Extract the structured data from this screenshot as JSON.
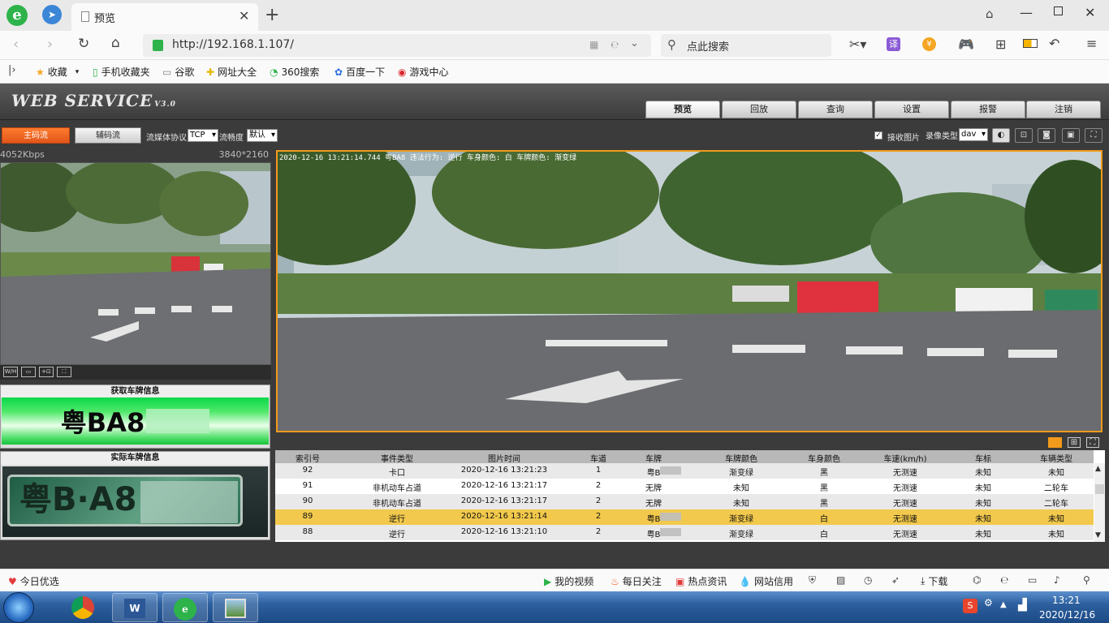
{
  "browser": {
    "tab_title": "预览",
    "url": "http://192.168.1.107/",
    "search_placeholder": "点此搜索",
    "translate_label": "译",
    "favorites": [
      "收藏",
      "手机收藏夹",
      "谷歌",
      "网址大全",
      "360搜索",
      "百度一下",
      "游戏中心"
    ]
  },
  "app": {
    "logo": "WEB SERVICE",
    "logo_version": "V3.0",
    "nav_tabs": [
      "预览",
      "回放",
      "查询",
      "设置",
      "报警",
      "注销"
    ],
    "active_tab": "预览",
    "toolbar": {
      "main_stream": "主码流",
      "sub_stream": "辅码流",
      "protocol_label": "流媒体协议",
      "protocol_value": "TCP",
      "smooth_label": "流畅度",
      "smooth_value": "默认",
      "receive_image_label": "接收图片",
      "record_type_label": "录像类型",
      "record_type_value": "dav"
    },
    "stream_info": {
      "bitrate": "4052Kbps",
      "resolution": "3840*2160"
    },
    "thumb_tools": [
      "W/H",
      "▭",
      "+⊡",
      "⛶"
    ],
    "plate_capture_title": "获取车牌信息",
    "plate_capture_value": "粤BA8",
    "plate_actual_title": "实际车牌信息",
    "plate_actual_value": "粤B·A8",
    "osd_text": "2020-12-16 13:21:14.744 粤BA8      违法行为: 逆行 车身颜色: 白 车牌颜色: 渐变绿",
    "table": {
      "headers": [
        "索引号",
        "事件类型",
        "图片时间",
        "车道",
        "车牌",
        "车牌颜色",
        "车身颜色",
        "车速(km/h)",
        "车标",
        "车辆类型"
      ],
      "rows": [
        [
          "92",
          "卡口",
          "2020-12-16 13:21:23",
          "1",
          "粤B",
          "渐变绿",
          "黑",
          "无测速",
          "未知",
          "未知"
        ],
        [
          "91",
          "非机动车占道",
          "2020-12-16 13:21:17",
          "2",
          "无牌",
          "未知",
          "黑",
          "无测速",
          "未知",
          "二轮车"
        ],
        [
          "90",
          "非机动车占道",
          "2020-12-16 13:21:17",
          "2",
          "无牌",
          "未知",
          "黑",
          "无测速",
          "未知",
          "二轮车"
        ],
        [
          "89",
          "逆行",
          "2020-12-16 13:21:14",
          "2",
          "粤B",
          "渐变绿",
          "白",
          "无测速",
          "未知",
          "未知"
        ],
        [
          "88",
          "逆行",
          "2020-12-16 13:21:10",
          "2",
          "粤B",
          "渐变绿",
          "白",
          "无测速",
          "未知",
          "未知"
        ]
      ],
      "selected_index": 3
    }
  },
  "status_bar": {
    "left": "今日优选",
    "items": [
      "我的视频",
      "每日关注",
      "热点资讯",
      "网站信用"
    ],
    "download": "下载"
  },
  "taskbar": {
    "time": "13:21",
    "date": "2020/12/16"
  },
  "colors": {
    "accent_orange": "#f29a1b",
    "selected_row": "#f2c94c",
    "plate_green": "#2ee060"
  }
}
